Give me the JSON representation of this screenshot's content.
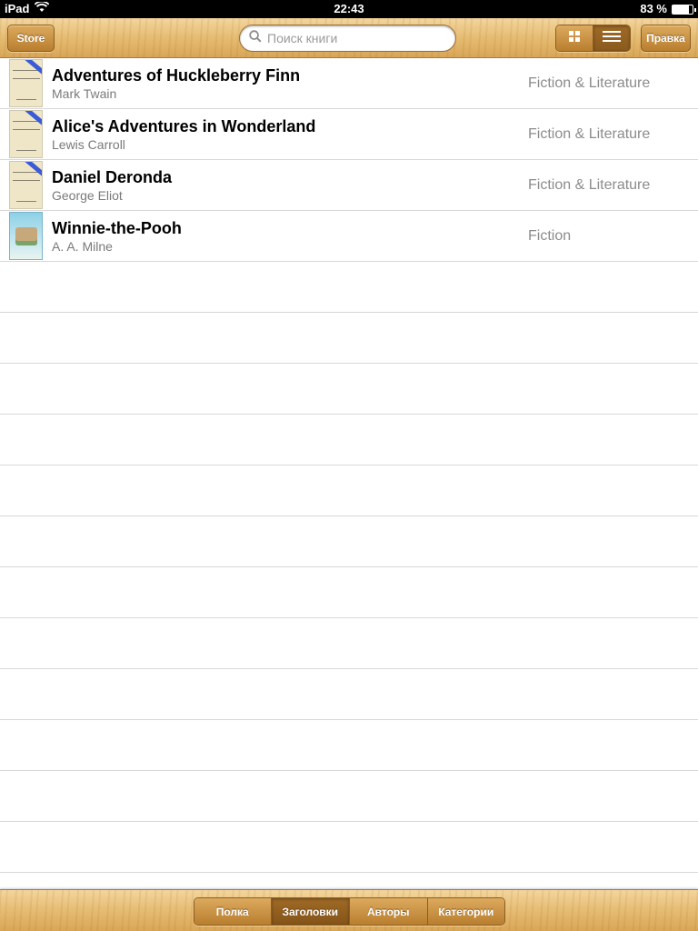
{
  "status_bar": {
    "device": "iPad",
    "time": "22:43",
    "battery": "83 %",
    "battery_level": 0.83,
    "wifi_icon": "wifi-icon",
    "battery_icon": "battery-icon"
  },
  "toolbar": {
    "store_label": "Store",
    "search_placeholder": "Поиск книги",
    "search_value": "",
    "grid_view_icon": "grid-view-icon",
    "list_view_icon": "list-view-icon",
    "active_view": "list",
    "edit_label": "Правка"
  },
  "books": [
    {
      "title": "Adventures of Huckleberry Finn",
      "author": "Mark Twain",
      "category": "Fiction & Literature",
      "new_ribbon": true
    },
    {
      "title": "Alice's Adventures in Wonderland",
      "author": "Lewis Carroll",
      "category": "Fiction & Literature",
      "new_ribbon": true
    },
    {
      "title": "Daniel Deronda",
      "author": "George Eliot",
      "category": "Fiction & Literature",
      "new_ribbon": true
    },
    {
      "title": "Winnie-the-Pooh",
      "author": "A. A. Milne",
      "category": "Fiction",
      "new_ribbon": false
    }
  ],
  "bottom_tabs": {
    "items": [
      "Полка",
      "Заголовки",
      "Авторы",
      "Категории"
    ],
    "active_index": 1
  },
  "colors": {
    "wood_light": "#f3d59d",
    "wood_dark": "#d9a657",
    "button_wood": "#b97e2f",
    "ribbon_blue": "#3a5bd8",
    "category_gray": "#8c8c8c"
  }
}
